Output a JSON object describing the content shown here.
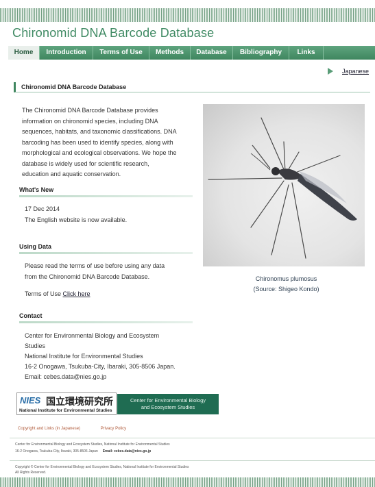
{
  "site": {
    "title": "Chironomid DNA Barcode Database"
  },
  "nav": {
    "tabs": [
      {
        "label": "Home",
        "active": true
      },
      {
        "label": "Introduction",
        "active": false
      },
      {
        "label": "Terms of Use",
        "active": false
      },
      {
        "label": "Methods",
        "active": false
      },
      {
        "label": "Database",
        "active": false
      },
      {
        "label": "Bibliography",
        "active": false
      },
      {
        "label": "Links",
        "active": false
      }
    ]
  },
  "language_link": "Japanese",
  "main": {
    "section_title": "Chironomid DNA Barcode Database",
    "intro_lines": [
      "The Chironomid DNA Barcode Database provides",
      "information on chironomid species, including DNA",
      "sequences, habitats, and taxonomic classifications. DNA",
      "barcoding has been used to identify species, along with",
      "morphological and ecological observations. We hope the",
      "database is widely used for scientific research,",
      "education and aquatic conservation."
    ]
  },
  "whats_new": {
    "heading": "What's New",
    "date": "17 Dec 2014",
    "text": "The English website is now available."
  },
  "using_data": {
    "heading": "Using Data",
    "line1": "Please read the terms of use before using any data",
    "line2": "from the Chironomid DNA Barcode Database.",
    "terms_label": "Terms of Use",
    "click_label": "Click here"
  },
  "contact": {
    "heading": "Contact",
    "lines": [
      "Center for Environmental Biology and Ecosystem",
      "Studies",
      "National Institute for Environmental Studies",
      "16-2 Onogawa, Tsukuba-City, Ibaraki, 305-8506 Japan.",
      "Email: cebes.data@nies.go.jp"
    ]
  },
  "photo": {
    "caption_name": "Chironomus plumosus",
    "caption_source": "(Source: Shigeo Kondo)"
  },
  "logos": {
    "nies_mark": "NIES",
    "nies_jp": "国立環境研究所",
    "nies_en": "National Institute for Environmental Studies",
    "cebes_line1": "Center for Environmental Biology",
    "cebes_line2": "and Ecosystem Studies"
  },
  "footer": {
    "links": [
      "Copyright and Links (in Japanese)",
      "Privacy Policy"
    ],
    "org": "Center for Environmental Biology and Ecosystem Studies, National Institute for Environmental Studies",
    "address": "16-2 Onogawa, Tsukuba-City, Ibaraki, 305-8506 Japan",
    "email": "Email: cebes.data@nies.go.jp",
    "copyright": "Copyright © Center for Environmental Biology and Ecosystem Studies, National Institute for Environmental Studies",
    "rights": "All Rights Reserved."
  }
}
